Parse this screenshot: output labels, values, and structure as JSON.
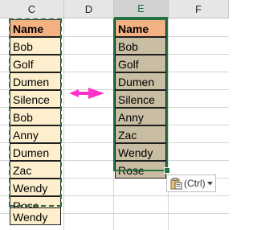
{
  "columns": [
    "C",
    "D",
    "E",
    "F"
  ],
  "source": {
    "header": "Name",
    "items": [
      "Bob",
      "Golf",
      "Dumen",
      "Silence",
      "Bob",
      "Anny",
      "Dumen",
      "Zac",
      "Wendy",
      "Rose",
      "Wendy"
    ]
  },
  "destination": {
    "header": "Name",
    "items": [
      "Bob",
      "Golf",
      "Dumen",
      "Silence",
      "Anny",
      "Zac",
      "Wendy",
      "Rose"
    ]
  },
  "paste_options": {
    "label": "(Ctrl)",
    "dropdown_icon": "chevron-down-icon",
    "clipboard_icon": "clipboard-icon"
  },
  "colors": {
    "header_fill": "#f4b183",
    "source_fill": "#fdefcd",
    "destination_fill": "#c9bea3",
    "arrow": "#ff33cc",
    "selection": "#217346"
  }
}
